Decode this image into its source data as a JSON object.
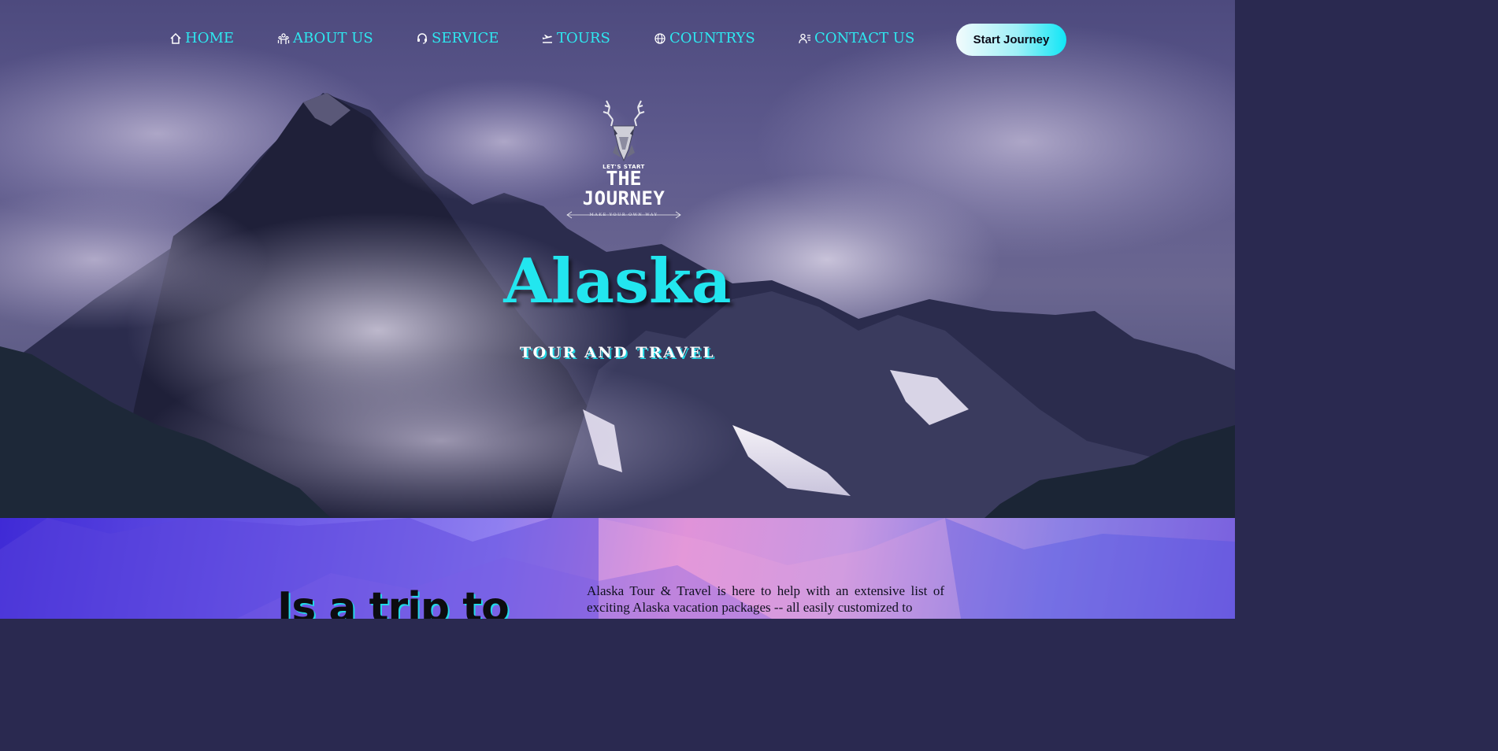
{
  "nav": {
    "items": [
      {
        "label": "HOME",
        "icon": "home-icon"
      },
      {
        "label": "ABOUT US",
        "icon": "people-icon"
      },
      {
        "label": "SERVICE",
        "icon": "headset-icon"
      },
      {
        "label": "TOURS",
        "icon": "plane-departure-icon"
      },
      {
        "label": "COUNTRYS",
        "icon": "globe-icon"
      },
      {
        "label": "CONTACT US",
        "icon": "contact-user-icon"
      }
    ],
    "cta_label": "Start Journey"
  },
  "logo": {
    "tagline": "LET'S START",
    "line1": "THE",
    "line2": "JOURNEY",
    "subline": "MAKE YOUR OWN WAY"
  },
  "hero": {
    "title": "Alaska",
    "subtitle": "TOUR AND TRAVEL"
  },
  "intro": {
    "heading": "Is a trip to",
    "text": "Alaska Tour & Travel is here to help with an extensive list of exciting Alaska vacation packages -- all easily customized to"
  },
  "colors": {
    "accent": "#22e6ef",
    "nav_text": "#2ee8f0",
    "hero_overlay": "#5f5b8e"
  }
}
